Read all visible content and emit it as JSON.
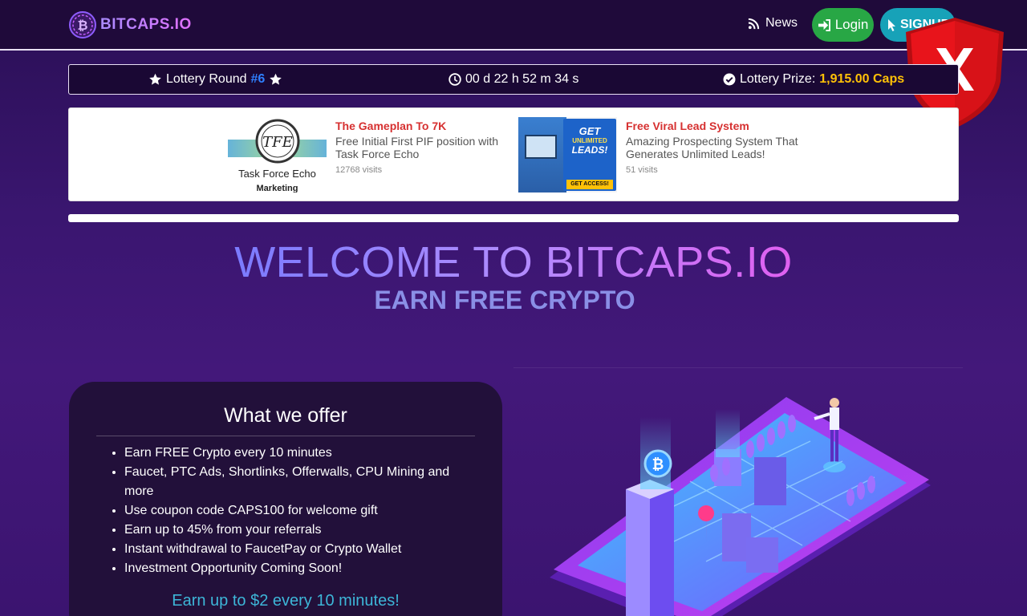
{
  "navbar": {
    "brand": "BITCAPS.IO",
    "news": "News",
    "login": "Login",
    "signup": "SIGNUP"
  },
  "lottery": {
    "round_label": "Lottery Round",
    "round_number": "#6",
    "timer": "00 d 22 h 52 m 34 s",
    "prize_label": "Lottery Prize:",
    "prize_value": "1,915.00 Caps"
  },
  "ads": [
    {
      "title": "The Gameplan To 7K",
      "description": "Free Initial First PIF position with Task Force Echo",
      "visits": "12768 visits",
      "image_caption": "Task Force Echo",
      "image_caption2": "Marketing"
    },
    {
      "title": "Free Viral Lead System",
      "description": "Amazing Prospecting System That Generates Unlimited Leads!",
      "visits": "51 visits",
      "image_line1": "GET",
      "image_line2": "UNLIMITED",
      "image_line3": "LEADS!",
      "image_cta": "GET ACCESS!"
    }
  ],
  "hero": {
    "title": "WELCOME TO BITCAPS.IO",
    "subtitle": "EARN FREE CRYPTO"
  },
  "offer": {
    "title": "What we offer",
    "items": [
      "Earn FREE Crypto every 10 minutes",
      "Faucet, PTC Ads, Shortlinks, Offerwalls, CPU Mining and more",
      "Use coupon code CAPS100 for welcome gift",
      "Earn up to 45% from your referrals",
      "Instant withdrawal to FaucetPay or Crypto Wallet",
      "Investment Opportunity Coming Soon!"
    ],
    "earn": "Earn up to $2 every 10 minutes!"
  },
  "colors": {
    "login": "#28a745",
    "signup": "#17a2b8",
    "round_number": "#2f80ff",
    "prize": "#ffc107",
    "ad_title": "#d63030",
    "shield": "#e8141b"
  }
}
